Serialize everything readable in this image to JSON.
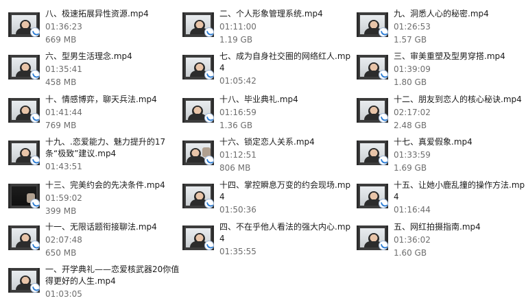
{
  "files": [
    {
      "name": "八、极速拓展异性资源.mp4",
      "duration": "01:36:23",
      "size": "669 MB"
    },
    {
      "name": "二、个人形象管理系统.mp4",
      "duration": "01:11:00",
      "size": "1.19 GB"
    },
    {
      "name": "九、洞悉人心的秘密.mp4",
      "duration": "01:26:53",
      "size": "1.57 GB"
    },
    {
      "name": "六、型男生活理念.mp4",
      "duration": "01:35:41",
      "size": "458 MB"
    },
    {
      "name": "七、成为自身社交圈的网络红人.mp4",
      "duration": "01:05:42",
      "size": ""
    },
    {
      "name": "三、审美重塑及型男穿搭.mp4",
      "duration": "01:39:09",
      "size": "1.80 GB"
    },
    {
      "name": "十、情感博弈，聊天兵法.mp4",
      "duration": "01:41:44",
      "size": "769 MB"
    },
    {
      "name": "十八、毕业典礼.mp4",
      "duration": "01:16:59",
      "size": "1.36 GB"
    },
    {
      "name": "十二、朋友到恋人的核心秘诀.mp4",
      "duration": "02:17:02",
      "size": "2.48 GB"
    },
    {
      "name": "十九、.恋爱能力、魅力提升的17条“极致”建议.mp4",
      "duration": "01:43:51",
      "size": ""
    },
    {
      "name": "十六、锁定恋人关系.mp4",
      "duration": "01:12:51",
      "size": "806 MB"
    },
    {
      "name": "十七、真爱假象.mp4",
      "duration": "01:33:59",
      "size": "1.69 GB"
    },
    {
      "name": "十三、完美约会的先决条件.mp4",
      "duration": "01:59:02",
      "size": "399 MB"
    },
    {
      "name": "十四、掌控瞬息万变的约会现场.mp4",
      "duration": "01:50:36",
      "size": ""
    },
    {
      "name": "十五、让她小鹿乱撞的操作方法.mp4",
      "duration": "01:16:44",
      "size": ""
    },
    {
      "name": "十一、无限话题衔接聊法.mp4",
      "duration": "02:07:48",
      "size": "650 MB"
    },
    {
      "name": "四、不在乎他人看法的强大内心.mp4",
      "duration": "01:35:55",
      "size": ""
    },
    {
      "name": "五、网红拍摄指南.mp4",
      "duration": "01:36:02",
      "size": "1.60 GB"
    },
    {
      "name": "一、开学典礼——恋爱核武器20你值得更好的人生.mp4",
      "duration": "01:03:05",
      "size": ""
    }
  ]
}
